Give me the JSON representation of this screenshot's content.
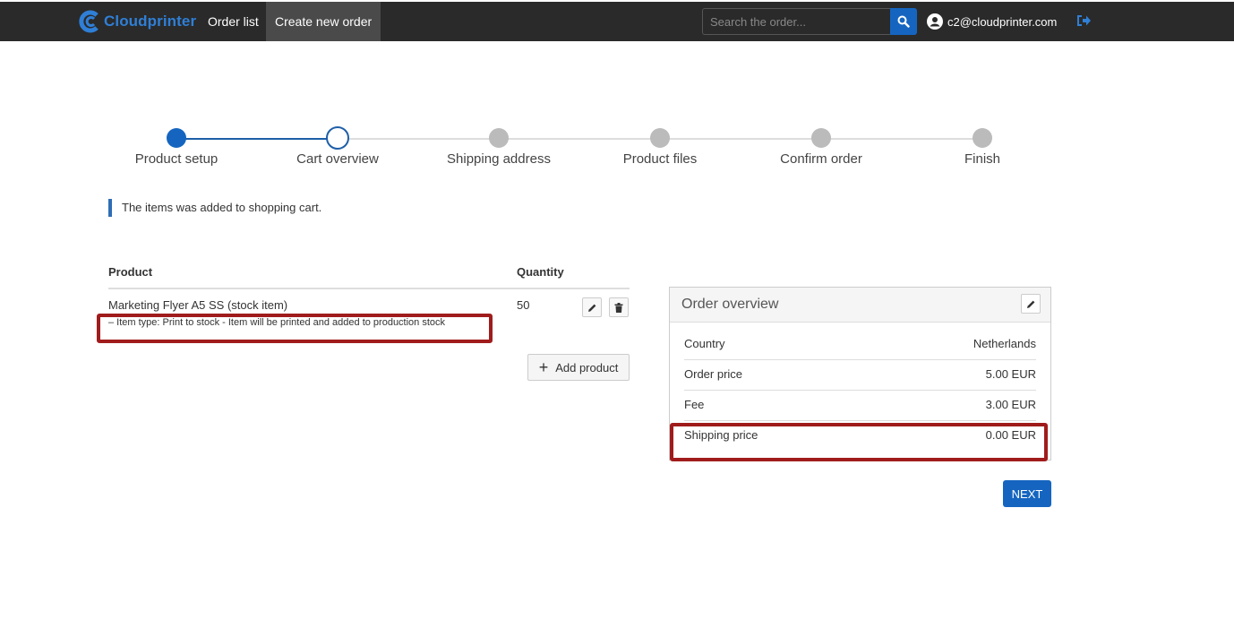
{
  "nav": {
    "brand": "Cloudprinter",
    "links": [
      "Order list",
      "Create new order"
    ],
    "search_placeholder": "Search the order...",
    "user_email": "c2@cloudprinter.com"
  },
  "steps": [
    "Product setup",
    "Cart overview",
    "Shipping address",
    "Product files",
    "Confirm order",
    "Finish"
  ],
  "current_step": 2,
  "alert": "The items was added to shopping cart.",
  "cart": {
    "headers": {
      "product": "Product",
      "quantity": "Quantity"
    },
    "items": [
      {
        "name": "Marketing Flyer A5 SS (stock item)",
        "desc": "– Item type: Print to stock - Item will be printed and added to production stock",
        "qty": "50"
      }
    ],
    "add_label": "Add product"
  },
  "overview": {
    "title": "Order overview",
    "rows": [
      {
        "label": "Country",
        "value": "Netherlands"
      },
      {
        "label": "Order price",
        "value": "5.00 EUR"
      },
      {
        "label": "Fee",
        "value": "3.00 EUR"
      },
      {
        "label": "Shipping price",
        "value": "0.00 EUR"
      }
    ]
  },
  "next_label": "NEXT",
  "colors": {
    "navbar": "#2a2a2a",
    "accent": "#1565c0",
    "highlight": "#a01c1c"
  }
}
